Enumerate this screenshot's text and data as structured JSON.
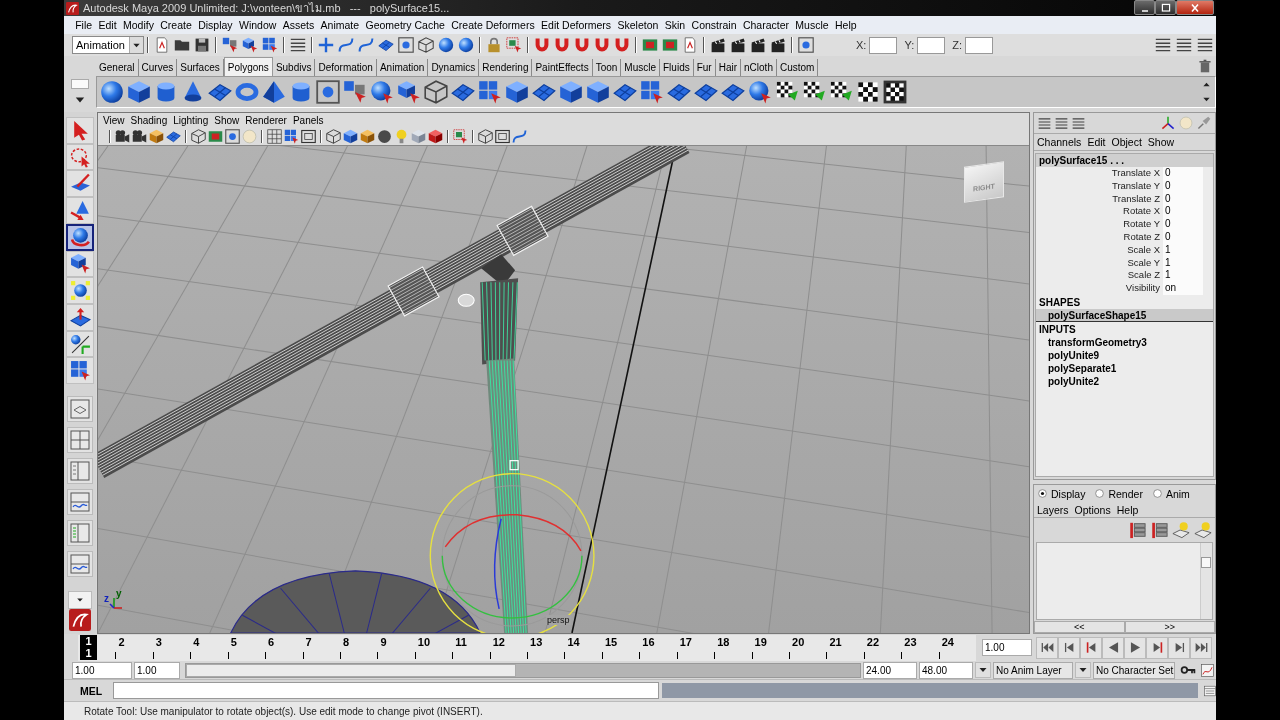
{
  "window": {
    "title": "Autodesk Maya 2009 Unlimited: J:\\vonteen\\ขาไม.mb   ---   polySurface15..."
  },
  "menu_bar": [
    "File",
    "Edit",
    "Modify",
    "Create",
    "Display",
    "Window",
    "Assets",
    "Animate",
    "Geometry Cache",
    "Create Deformers",
    "Edit Deformers",
    "Skeleton",
    "Skin",
    "Constrain",
    "Character",
    "Muscle",
    "Help"
  ],
  "status_line": {
    "menu_set": "Animation",
    "fields": [
      {
        "label": "X:"
      },
      {
        "label": "Y:"
      },
      {
        "label": "Z:"
      }
    ]
  },
  "shelf": {
    "tabs": [
      {
        "label": "General",
        "selected": false
      },
      {
        "label": "Curves",
        "selected": false
      },
      {
        "label": "Surfaces",
        "selected": false
      },
      {
        "label": "Polygons",
        "selected": true
      },
      {
        "label": "Subdivs",
        "selected": false
      },
      {
        "label": "Deformation",
        "selected": false
      },
      {
        "label": "Animation",
        "selected": false
      },
      {
        "label": "Dynamics",
        "selected": false
      },
      {
        "label": "Rendering",
        "selected": false
      },
      {
        "label": "PaintEffects",
        "selected": false
      },
      {
        "label": "Toon",
        "selected": false
      },
      {
        "label": "Muscle",
        "selected": false
      },
      {
        "label": "Fluids",
        "selected": false
      },
      {
        "label": "Fur",
        "selected": false
      },
      {
        "label": "Hair",
        "selected": false
      },
      {
        "label": "nCloth",
        "selected": false
      },
      {
        "label": "Custom",
        "selected": false
      }
    ]
  },
  "toolbox": {
    "tools": [
      {
        "selected": false
      },
      {
        "selected": false
      },
      {
        "selected": false
      },
      {
        "selected": false
      },
      {
        "selected": true
      },
      {
        "selected": false
      },
      {
        "selected": false
      },
      {
        "selected": false
      },
      {
        "selected": false
      },
      {
        "selected": false
      }
    ]
  },
  "viewport": {
    "menus": [
      "View",
      "Shading",
      "Lighting",
      "Show",
      "Renderer",
      "Panels"
    ],
    "view_cube_label": "RIGHT",
    "axis_labels": [
      "z",
      "y"
    ],
    "camera": "persp"
  },
  "channel_box": {
    "menus": [
      "Channels",
      "Edit",
      "Object",
      "Show"
    ],
    "object": "polySurface15 . . .",
    "channels": [
      {
        "name": "Translate X",
        "value": "0"
      },
      {
        "name": "Translate Y",
        "value": "0"
      },
      {
        "name": "Translate Z",
        "value": "0"
      },
      {
        "name": "Rotate X",
        "value": "0"
      },
      {
        "name": "Rotate Y",
        "value": "0"
      },
      {
        "name": "Rotate Z",
        "value": "0"
      },
      {
        "name": "Scale X",
        "value": "1"
      },
      {
        "name": "Scale Y",
        "value": "1"
      },
      {
        "name": "Scale Z",
        "value": "1"
      },
      {
        "name": "Visibility",
        "value": "on"
      }
    ],
    "shapes_heading": "SHAPES",
    "shapes": [
      {
        "label": "polySurfaceShape15",
        "selected": true
      }
    ],
    "inputs_heading": "INPUTS",
    "inputs": [
      "transformGeometry3",
      "polyUnite9",
      "polySeparate1",
      "polyUnite2"
    ]
  },
  "layer_editor": {
    "modes": [
      {
        "label": "Display",
        "selected": true
      },
      {
        "label": "Render",
        "selected": false
      },
      {
        "label": "Anim",
        "selected": false
      }
    ],
    "menus": [
      "Layers",
      "Options",
      "Help"
    ],
    "page_buttons": [
      "<<",
      ">>"
    ]
  },
  "time_slider": {
    "frames": [
      {
        "label": "1",
        "selected": true
      },
      {
        "label": "2",
        "selected": false
      },
      {
        "label": "3",
        "selected": false
      },
      {
        "label": "4",
        "selected": false
      },
      {
        "label": "5",
        "selected": false
      },
      {
        "label": "6",
        "selected": false
      },
      {
        "label": "7",
        "selected": false
      },
      {
        "label": "8",
        "selected": false
      },
      {
        "label": "9",
        "selected": false
      },
      {
        "label": "10",
        "selected": false
      },
      {
        "label": "11",
        "selected": false
      },
      {
        "label": "12",
        "selected": false
      },
      {
        "label": "13",
        "selected": false
      },
      {
        "label": "14",
        "selected": false
      },
      {
        "label": "15",
        "selected": false
      },
      {
        "label": "16",
        "selected": false
      },
      {
        "label": "17",
        "selected": false
      },
      {
        "label": "18",
        "selected": false
      },
      {
        "label": "19",
        "selected": false
      },
      {
        "label": "20",
        "selected": false
      },
      {
        "label": "21",
        "selected": false
      },
      {
        "label": "22",
        "selected": false
      },
      {
        "label": "23",
        "selected": false
      },
      {
        "label": "24",
        "selected": false
      }
    ],
    "current_frame": "1",
    "current_time": "1.00"
  },
  "range_slider": {
    "start_time": "1.00",
    "playback_start": "1.00",
    "playback_end": "24.00",
    "end_time": "48.00",
    "anim_layer": "No Anim Layer",
    "character_set": "No Character Set"
  },
  "command_line": {
    "language": "MEL"
  },
  "help_line": "Rotate Tool: Use manipulator to rotate object(s). Use edit mode to change pivot (INSERT)."
}
